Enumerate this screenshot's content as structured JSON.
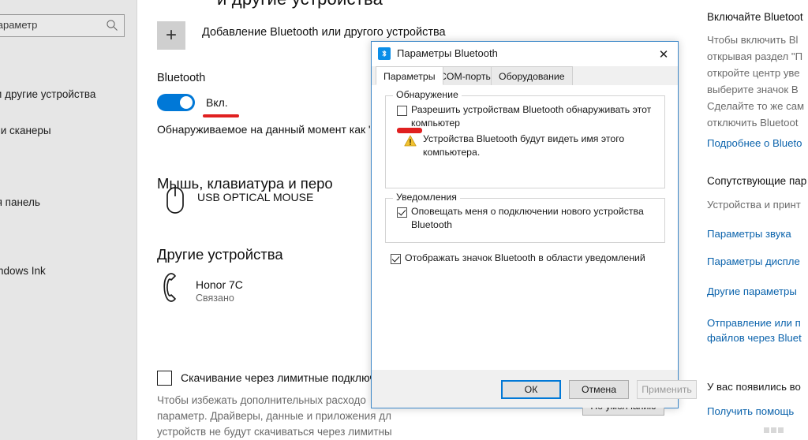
{
  "window": {
    "page_title_partial": "и другие устройства"
  },
  "sidebar": {
    "search": {
      "placeholder": "Найти параметр",
      "icon": "search-icon"
    },
    "items": [
      {
        "label": "Bluetooth и другие устройства"
      },
      {
        "label": "Принтеры и сканеры"
      },
      {
        "label": "Сенсорная панель"
      },
      {
        "label": "Перо и Windows Ink"
      }
    ]
  },
  "main": {
    "add_device": {
      "label": "Добавление Bluetooth или другого устройства",
      "icon": "plus-icon"
    },
    "bluetooth": {
      "label": "Bluetooth",
      "toggle_state": "Вкл.",
      "toggle_on": true,
      "discoverable_text": "Обнаруживаемое на данный момент как \""
    },
    "sections": [
      {
        "heading": "Мышь, клавиатура и перо",
        "devices": [
          {
            "name": "USB OPTICAL MOUSE",
            "status": "",
            "icon": "mouse-icon"
          }
        ]
      },
      {
        "heading": "Другие устройства",
        "devices": [
          {
            "name": "Honor 7C",
            "status": "Связано",
            "icon": "phone-icon"
          }
        ]
      }
    ],
    "metered": {
      "checkbox_label": "Скачивание через лимитные подключ",
      "checked": false,
      "description": "Чтобы избежать дополнительных расходо\nпараметр. Драйверы, данные и приложения дл\nустройств не будут скачиваться через лимитны"
    }
  },
  "right_panel": {
    "blocks": [
      {
        "type": "title",
        "text": "Включайте Bluetoot"
      },
      {
        "type": "body",
        "text": "Чтобы включить Bl\nоткрывая раздел \"П\nоткройте центр уве\nвыберите значок B\nСделайте то же сам\nотключить Bluetoot"
      },
      {
        "type": "link",
        "text": "Подробнее о Bluetо"
      },
      {
        "type": "title",
        "text": "Сопутствующие пар"
      },
      {
        "type": "body",
        "text": "Устройства и принт"
      },
      {
        "type": "link",
        "text": "Параметры звука"
      },
      {
        "type": "link",
        "text": "Параметры дисплe"
      },
      {
        "type": "link",
        "text": "Другие параметры"
      },
      {
        "type": "link",
        "text": "Отправление или п\nфайлов через Bluet"
      },
      {
        "type": "plain",
        "text": "У вас появились во"
      },
      {
        "type": "link",
        "text": "Получить помощь"
      }
    ]
  },
  "dialog": {
    "title": "Параметры Bluetooth",
    "icon": "bluetooth-icon",
    "close_label": "✕",
    "tabs": [
      {
        "label": "Параметры",
        "active": true
      },
      {
        "label": "COM-порты",
        "active": false
      },
      {
        "label": "Оборудование",
        "active": false
      }
    ],
    "discovery_group": {
      "legend": "Обнаружение",
      "checkbox": {
        "label": "Разрешить устройствам Bluetooth обнаруживать этот\nкомпьютер",
        "checked": false
      },
      "warning": {
        "icon": "warning-icon",
        "text": "Устройства Bluetooth будут видеть имя этого\nкомпьютера."
      }
    },
    "notifications_group": {
      "legend": "Уведомления",
      "checkbox": {
        "label": "Оповещать меня о подключении нового устройства\nBluetooth",
        "checked": true
      }
    },
    "tray_checkbox": {
      "label": "Отображать значок Bluetooth в области уведомлений",
      "checked": true
    },
    "buttons": {
      "defaults": "По умолчанию",
      "ok": "ОК",
      "cancel": "Отмена",
      "apply": "Применить"
    }
  },
  "colors": {
    "accent": "#0078d7",
    "link": "#0b63ac",
    "annotation_red": "#e02020",
    "warning_yellow": "#f2c230"
  }
}
